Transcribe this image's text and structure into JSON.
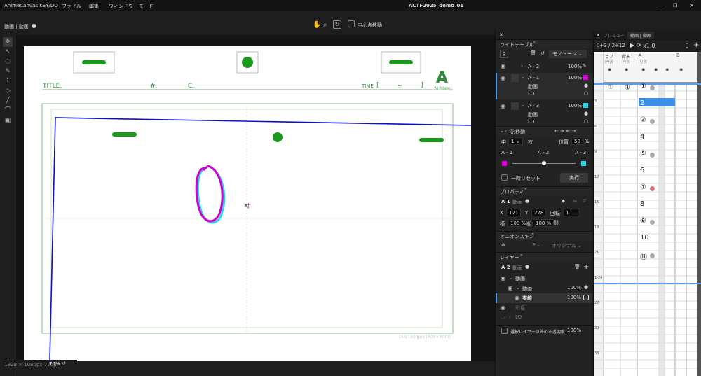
{
  "app": {
    "name": "AnimeCanvas KEY/DO",
    "menu": [
      "ファイル",
      "編集",
      "ウィンドウ",
      "モード"
    ],
    "doc_title": "ACTF2025_demo_01"
  },
  "toolbar": {
    "breadcrumb": "動画 | 動画",
    "center_move_label": "中心点移動"
  },
  "status": {
    "resolution": "1920 × 1080px 72dpi",
    "zoom": "70%"
  },
  "canvas": {
    "title_label": "TITLE.",
    "number_label": "#.",
    "cut_label": "C.",
    "time_label": "TIME",
    "time_bracket_open": "[",
    "time_plus": "+",
    "time_bracket_close": "]",
    "logo_text": "A",
    "logo_sub": "A1 Pictures",
    "frame_caption": "(A4/150dpi (1600×900))"
  },
  "lighttable": {
    "header": "ライトテーブル",
    "mode": "モノトーン",
    "layers": [
      {
        "name": "A - 2",
        "opacity": "100%"
      },
      {
        "name": "A - 1",
        "opacity": "100%",
        "subs": [
          "動画",
          "LO"
        ]
      },
      {
        "name": "A - 3",
        "opacity": "100%",
        "subs": [
          "動画",
          "LO"
        ]
      }
    ],
    "colors": {
      "magenta": "#e000e0",
      "cyan": "#27d6e8"
    }
  },
  "midmove": {
    "header": "中割移動",
    "mid_label": "中",
    "mid_count": "1",
    "mid_unit": "枚",
    "pos_label": "位置",
    "pos_value": "50",
    "pos_unit": "%",
    "slider_labels": [
      "A - 1",
      "A - 2",
      "A - 3"
    ],
    "slider_pos": 0.5,
    "reset_label": "一時リセット",
    "exec_label": "実行"
  },
  "properties": {
    "header": "プロパティ",
    "layer": "A 1",
    "layer_type": "動画",
    "x_label": "X",
    "x": "121",
    "y_label": "Y",
    "y": "278",
    "rot_label": "回転",
    "rot": "1",
    "w_label": "横",
    "w": "100",
    "h_label": "縦",
    "h": "100",
    "pct": "%"
  },
  "onion": {
    "header": "オニオンスキン",
    "count": "3",
    "mode": "オリジナル"
  },
  "layers": {
    "header": "レイヤー",
    "current": "A 2",
    "current_type": "動画",
    "tree": [
      {
        "name": "動画",
        "opacity": ""
      },
      {
        "name": "動画",
        "opacity": "100%"
      },
      {
        "name": "実線",
        "opacity": "100%"
      },
      {
        "name": "彩色",
        "opacity": ""
      },
      {
        "name": "LO",
        "opacity": ""
      }
    ],
    "footer_label": "選択レイヤー以外の不透明度",
    "footer_value": "100%"
  },
  "timeline": {
    "tabs": [
      "プレビュー",
      "動画 | 動画"
    ],
    "counter": "0+3 / 2+12",
    "speed": "x1.0",
    "columns": [
      "ラフ",
      "背景",
      "A",
      "B"
    ],
    "col_subs": [
      "内容",
      "内容",
      "内容",
      ""
    ],
    "frames": [
      "①",
      "2",
      "③",
      "4",
      "⑤",
      "6",
      "⑦",
      "8",
      "⑨",
      "10",
      "⑪"
    ],
    "row_markers": [
      "3",
      "6",
      "9",
      "12",
      "15",
      "18",
      "21",
      "1-24",
      "27",
      "30",
      "33"
    ],
    "row1_circles": [
      "①",
      "①"
    ]
  }
}
